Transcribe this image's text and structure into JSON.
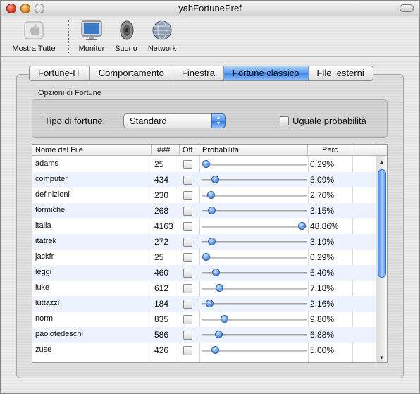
{
  "window": {
    "title": "yahFortunePref"
  },
  "toolbar": {
    "items": [
      {
        "label": "Mostra Tutte",
        "icon": "apple-icon"
      },
      {
        "label": "Monitor",
        "icon": "monitor-icon"
      },
      {
        "label": "Suono",
        "icon": "speaker-icon"
      },
      {
        "label": "Network",
        "icon": "network-globe-icon"
      }
    ]
  },
  "tabs": [
    {
      "label": "Fortune-IT",
      "active": false
    },
    {
      "label": "Comportamento",
      "active": false
    },
    {
      "label": "Finestra",
      "active": false
    },
    {
      "label": "Fortune classico",
      "active": true
    },
    {
      "label": "File  esterni",
      "active": false
    }
  ],
  "options": {
    "group_label": "Opzioni di Fortune",
    "tipo_label": "Tipo di fortune:",
    "tipo_value": "Standard",
    "uguale_label": "Uguale probabilità",
    "uguale_checked": false
  },
  "table": {
    "headers": {
      "name": "Nome del File",
      "count": "###",
      "off": "Off",
      "prob": "Probabilità",
      "perc": "Perc"
    },
    "rows": [
      {
        "name": "adams",
        "count": "25",
        "perc": "0.29%",
        "prob": 0.0029
      },
      {
        "name": "computer",
        "count": "434",
        "perc": "5.09%",
        "prob": 0.0509
      },
      {
        "name": "definizioni",
        "count": "230",
        "perc": "2.70%",
        "prob": 0.027
      },
      {
        "name": "formiche",
        "count": "268",
        "perc": "3.15%",
        "prob": 0.0315
      },
      {
        "name": "italia",
        "count": "4163",
        "perc": "48.86%",
        "prob": 0.4886
      },
      {
        "name": "itatrek",
        "count": "272",
        "perc": "3.19%",
        "prob": 0.0319
      },
      {
        "name": "jackfr",
        "count": "25",
        "perc": "0.29%",
        "prob": 0.0029
      },
      {
        "name": "leggi",
        "count": "460",
        "perc": "5.40%",
        "prob": 0.054
      },
      {
        "name": "luke",
        "count": "612",
        "perc": "7.18%",
        "prob": 0.0718
      },
      {
        "name": "luttazzi",
        "count": "184",
        "perc": "2.16%",
        "prob": 0.0216
      },
      {
        "name": "norm",
        "count": "835",
        "perc": "9.80%",
        "prob": 0.098
      },
      {
        "name": "paolotedeschi",
        "count": "586",
        "perc": "6.88%",
        "prob": 0.0688
      },
      {
        "name": "zuse",
        "count": "426",
        "perc": "5.00%",
        "prob": 0.05
      }
    ]
  },
  "colors": {
    "accent": "#3f86e8",
    "row_alt": "#edf3fe"
  }
}
